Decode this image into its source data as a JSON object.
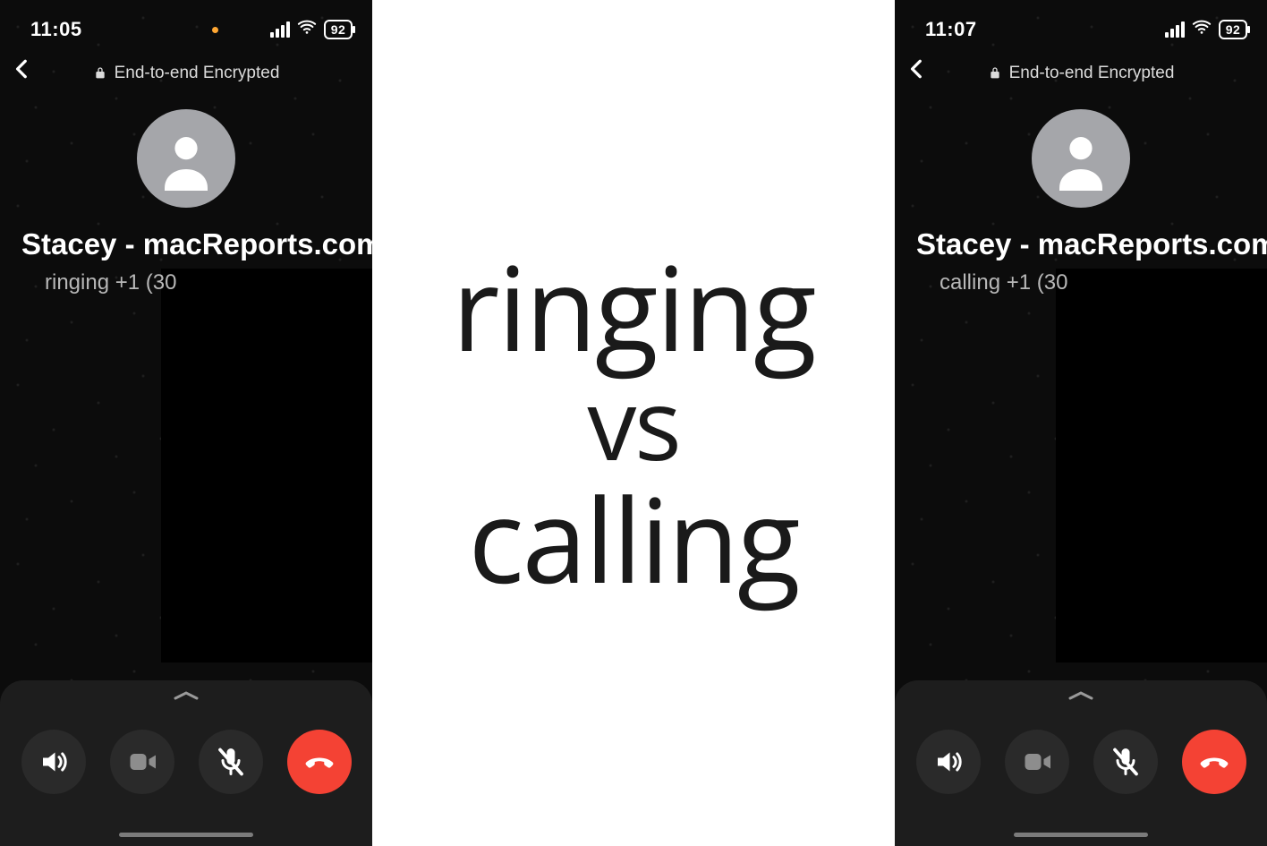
{
  "center": {
    "line1": "ringing",
    "line2": "vs",
    "line3": "calling"
  },
  "colors": {
    "end_call": "#f44234",
    "button_dark": "#2a2a2a"
  },
  "left": {
    "status": {
      "time": "11:05",
      "battery": "92",
      "orange_privacy_dot": true
    },
    "encryption_label": "End-to-end Encrypted",
    "contact_name": "Stacey - macReports.com",
    "call_status": "ringing +1 (30",
    "buttons": {
      "speaker": "speaker-icon",
      "video": "video-icon",
      "mute": "mic-off-icon",
      "end": "end-call-icon"
    }
  },
  "right": {
    "status": {
      "time": "11:07",
      "battery": "92",
      "orange_privacy_dot": false
    },
    "encryption_label": "End-to-end Encrypted",
    "contact_name": "Stacey - macReports.com",
    "call_status": "calling +1 (30",
    "buttons": {
      "speaker": "speaker-icon",
      "video": "video-icon",
      "mute": "mic-off-icon",
      "end": "end-call-icon"
    }
  }
}
